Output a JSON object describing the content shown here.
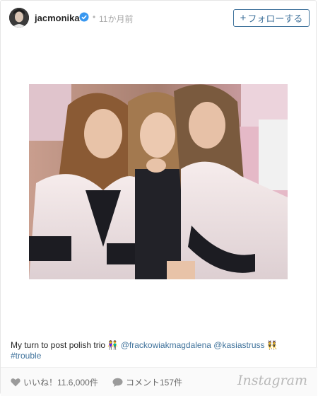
{
  "post": {
    "username": "jacmonika",
    "separator": "•",
    "time": "11か月前",
    "follow_label": "フォローする",
    "follow_plus": "+"
  },
  "caption": {
    "text": "My turn to post polish trio",
    "emoji1": "👫",
    "mention1": "@frackowiakmagdalena",
    "mention2": "@kasiastruss",
    "emoji2": "👯",
    "hashtag": "#trouble"
  },
  "footer": {
    "likes": "いいね！11.6,000件",
    "comments": "コメント157件",
    "brand": "Instagram"
  },
  "colors": {
    "link": "#3f729b",
    "verified": "#3897f0"
  }
}
